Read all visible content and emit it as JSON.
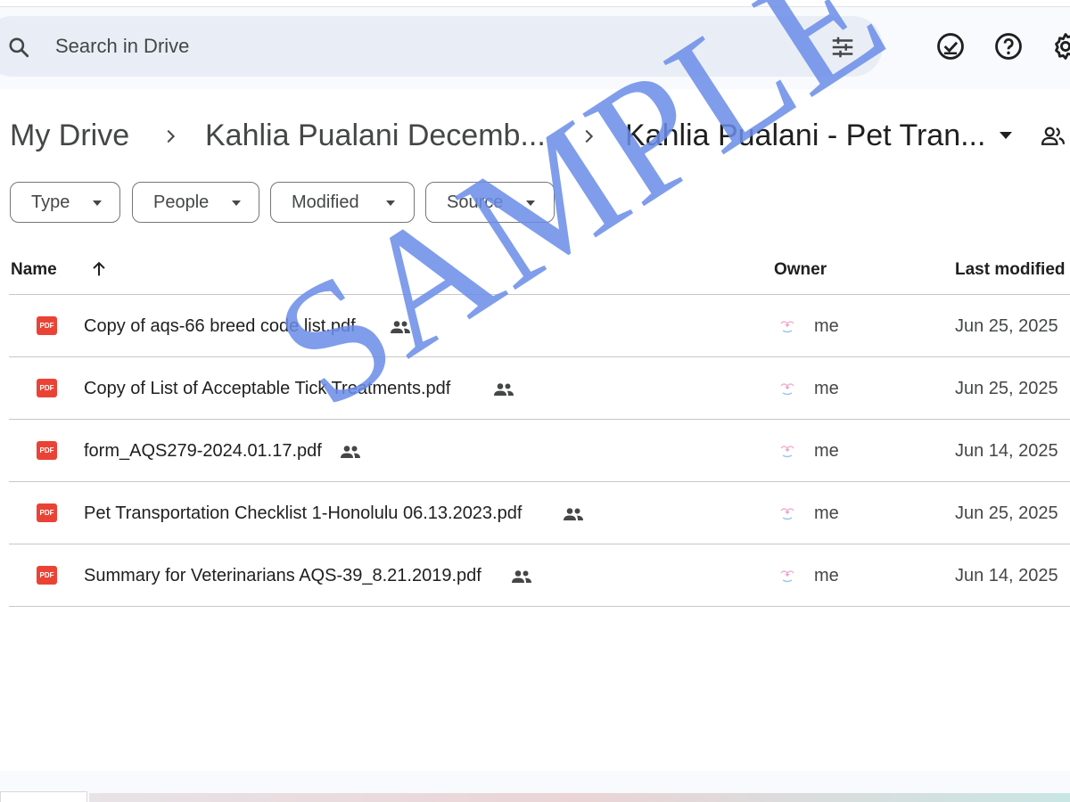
{
  "search": {
    "placeholder": "Search in Drive"
  },
  "breadcrumb": {
    "items": [
      "My Drive",
      "Kahlia Pualani Decemb...",
      "Kahlia Pualani - Pet Tran..."
    ]
  },
  "filters": [
    "Type",
    "People",
    "Modified",
    "Source"
  ],
  "table": {
    "headers": {
      "name": "Name",
      "owner": "Owner",
      "modified": "Last modified"
    },
    "rows": [
      {
        "name": "Copy of aqs-66 breed code list.pdf",
        "owner": "me",
        "modified": "Jun 25, 2025",
        "icon": "pdf-icon",
        "shared": true
      },
      {
        "name": "Copy of List of Acceptable Tick Treatments.pdf",
        "owner": "me",
        "modified": "Jun 25, 2025",
        "icon": "pdf-icon",
        "shared": true
      },
      {
        "name": "form_AQS279-2024.01.17.pdf",
        "owner": "me",
        "modified": "Jun 14, 2025",
        "icon": "pdf-icon",
        "shared": true
      },
      {
        "name": "Pet Transportation Checklist 1-Honolulu 06.13.2023.pdf",
        "owner": "me",
        "modified": "Jun 25, 2025",
        "icon": "pdf-icon",
        "shared": true
      },
      {
        "name": "Summary for Veterinarians AQS-39_8.21.2019.pdf",
        "owner": "me",
        "modified": "Jun 14, 2025",
        "icon": "pdf-icon",
        "shared": true
      }
    ]
  },
  "pdf_badge_label": "PDF",
  "watermark": "SAMPLE",
  "colors": {
    "accent": "#0b57d0",
    "search_bg": "#e9eef6",
    "pdf_red": "#ea4335",
    "watermark": "#6b8de8",
    "divider": "#c7c7c7"
  }
}
